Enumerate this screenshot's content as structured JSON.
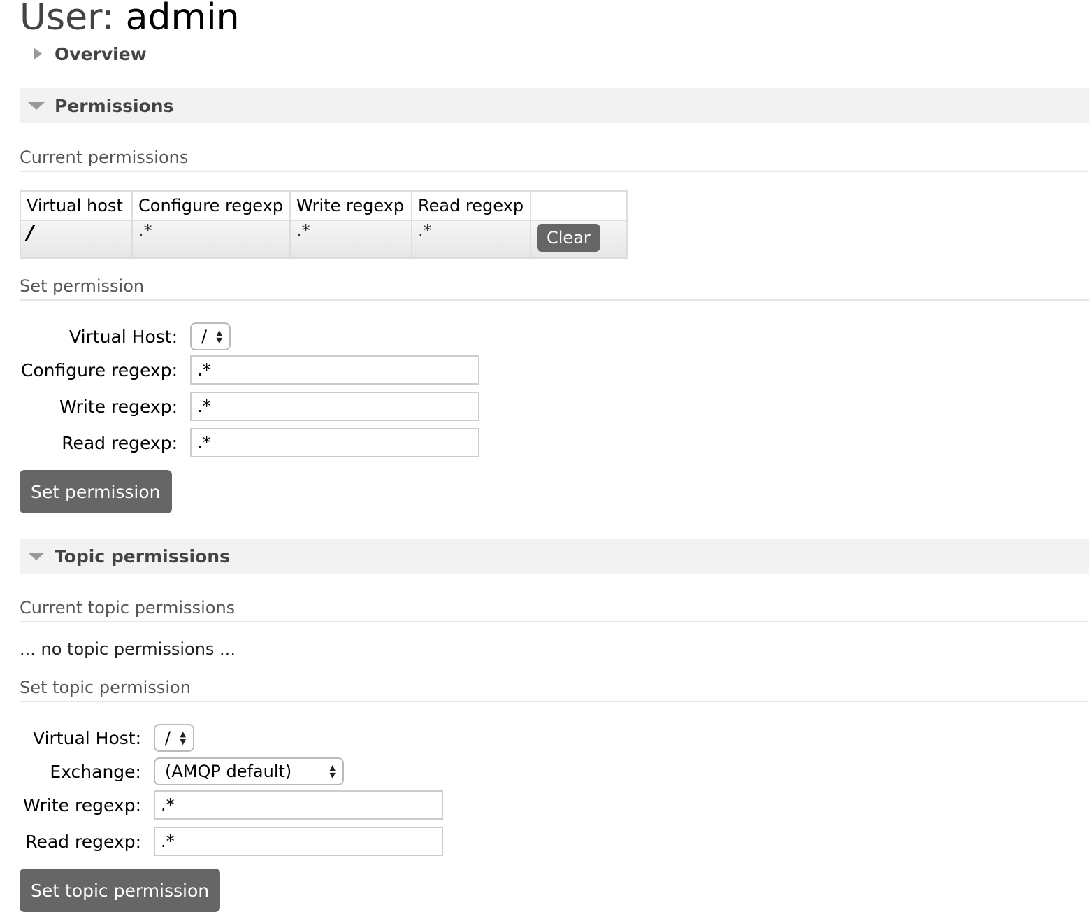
{
  "header": {
    "label": "User:",
    "username": "admin"
  },
  "sections": {
    "overview": {
      "heading": "Overview"
    },
    "permissions": {
      "heading": "Permissions",
      "current_heading": "Current permissions",
      "table": {
        "columns": [
          "Virtual host",
          "Configure regexp",
          "Write regexp",
          "Read regexp",
          ""
        ],
        "rows": [
          {
            "vhost": "/",
            "configure": ".*",
            "write": ".*",
            "read": ".*",
            "action": "Clear"
          }
        ]
      },
      "set_heading": "Set permission",
      "form": {
        "vhost_label": "Virtual Host:",
        "vhost_value": "/",
        "configure_label": "Configure regexp:",
        "configure_value": ".*",
        "write_label": "Write regexp:",
        "write_value": ".*",
        "read_label": "Read regexp:",
        "read_value": ".*",
        "submit": "Set permission"
      }
    },
    "topic_permissions": {
      "heading": "Topic permissions",
      "current_heading": "Current topic permissions",
      "empty_note": "... no topic permissions ...",
      "set_heading": "Set topic permission",
      "form": {
        "vhost_label": "Virtual Host:",
        "vhost_value": "/",
        "exchange_label": "Exchange:",
        "exchange_value": "(AMQP default)",
        "write_label": "Write regexp:",
        "write_value": ".*",
        "read_label": "Read regexp:",
        "read_value": ".*",
        "submit": "Set topic permission"
      }
    }
  },
  "icons": {
    "collapsed": "triangle-right-icon",
    "expanded": "triangle-down-icon",
    "select": "updown-arrows-icon"
  },
  "colors": {
    "button_bg": "#666666",
    "section_bg": "#f2f2f2",
    "arrow": "#9a9a9a"
  }
}
